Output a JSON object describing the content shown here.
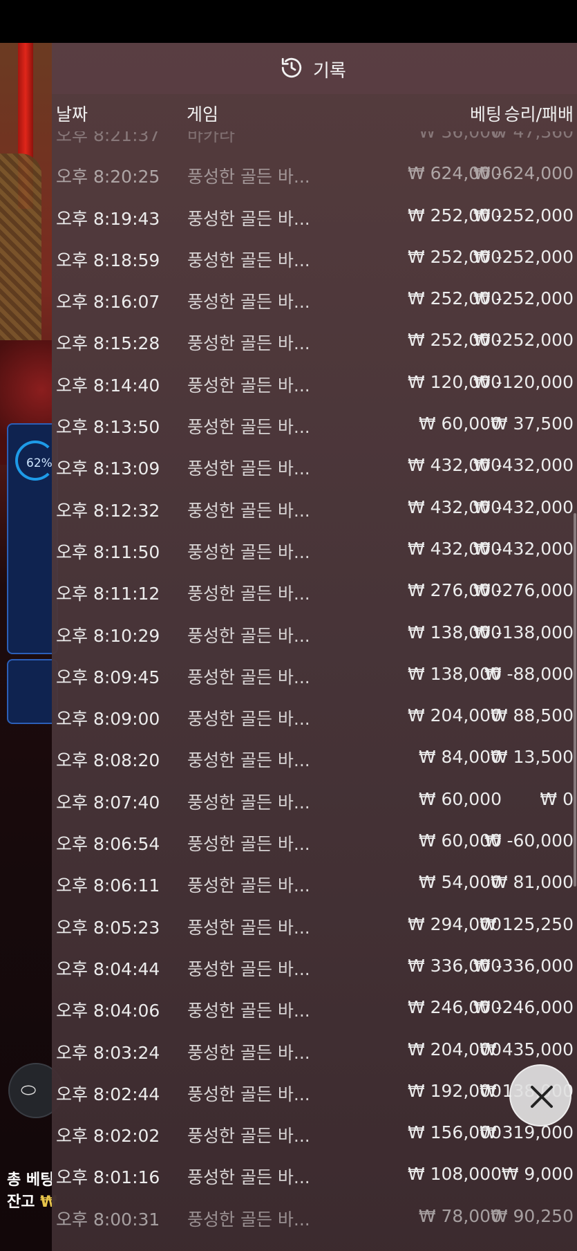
{
  "panel": {
    "title": "기록",
    "icon": "history-icon"
  },
  "columns": {
    "date": "날짜",
    "game": "게임",
    "bet": "베팅",
    "result": "승리/패배"
  },
  "rows": [
    {
      "date": "오후 8:21:37",
      "game": "바카라",
      "bet": "₩ 36,000",
      "result": "₩ 47,360"
    },
    {
      "date": "오후 8:20:25",
      "game": "풍성한 골든 바...",
      "bet": "₩ 624,000",
      "result": "₩ -624,000"
    },
    {
      "date": "오후 8:19:43",
      "game": "풍성한 골든 바...",
      "bet": "₩ 252,000",
      "result": "₩ -252,000"
    },
    {
      "date": "오후 8:18:59",
      "game": "풍성한 골든 바...",
      "bet": "₩ 252,000",
      "result": "₩ -252,000"
    },
    {
      "date": "오후 8:16:07",
      "game": "풍성한 골든 바...",
      "bet": "₩ 252,000",
      "result": "₩ -252,000"
    },
    {
      "date": "오후 8:15:28",
      "game": "풍성한 골든 바...",
      "bet": "₩ 252,000",
      "result": "₩ -252,000"
    },
    {
      "date": "오후 8:14:40",
      "game": "풍성한 골든 바...",
      "bet": "₩ 120,000",
      "result": "₩ -120,000"
    },
    {
      "date": "오후 8:13:50",
      "game": "풍성한 골든 바...",
      "bet": "₩ 60,000",
      "result": "₩ 37,500"
    },
    {
      "date": "오후 8:13:09",
      "game": "풍성한 골든 바...",
      "bet": "₩ 432,000",
      "result": "₩ -432,000"
    },
    {
      "date": "오후 8:12:32",
      "game": "풍성한 골든 바...",
      "bet": "₩ 432,000",
      "result": "₩ -432,000"
    },
    {
      "date": "오후 8:11:50",
      "game": "풍성한 골든 바...",
      "bet": "₩ 432,000",
      "result": "₩ -432,000"
    },
    {
      "date": "오후 8:11:12",
      "game": "풍성한 골든 바...",
      "bet": "₩ 276,000",
      "result": "₩ -276,000"
    },
    {
      "date": "오후 8:10:29",
      "game": "풍성한 골든 바...",
      "bet": "₩ 138,000",
      "result": "₩ -138,000"
    },
    {
      "date": "오후 8:09:45",
      "game": "풍성한 골든 바...",
      "bet": "₩ 138,000",
      "result": "₩ -88,000"
    },
    {
      "date": "오후 8:09:00",
      "game": "풍성한 골든 바...",
      "bet": "₩ 204,000",
      "result": "₩ 88,500"
    },
    {
      "date": "오후 8:08:20",
      "game": "풍성한 골든 바...",
      "bet": "₩ 84,000",
      "result": "₩ 13,500"
    },
    {
      "date": "오후 8:07:40",
      "game": "풍성한 골든 바...",
      "bet": "₩ 60,000",
      "result": "₩ 0"
    },
    {
      "date": "오후 8:06:54",
      "game": "풍성한 골든 바...",
      "bet": "₩ 60,000",
      "result": "₩ -60,000"
    },
    {
      "date": "오후 8:06:11",
      "game": "풍성한 골든 바...",
      "bet": "₩ 54,000",
      "result": "₩ 81,000"
    },
    {
      "date": "오후 8:05:23",
      "game": "풍성한 골든 바...",
      "bet": "₩ 294,000",
      "result": "₩ 125,250"
    },
    {
      "date": "오후 8:04:44",
      "game": "풍성한 골든 바...",
      "bet": "₩ 336,000",
      "result": "₩ -336,000"
    },
    {
      "date": "오후 8:04:06",
      "game": "풍성한 골든 바...",
      "bet": "₩ 246,000",
      "result": "₩ -246,000"
    },
    {
      "date": "오후 8:03:24",
      "game": "풍성한 골든 바...",
      "bet": "₩ 204,000",
      "result": "₩ 435,000"
    },
    {
      "date": "오후 8:02:44",
      "game": "풍성한 골든 바...",
      "bet": "₩ 192,000",
      "result": "₩ 138,000"
    },
    {
      "date": "오후 8:02:02",
      "game": "풍성한 골든 바...",
      "bet": "₩ 156,000",
      "result": "₩ 319,000"
    },
    {
      "date": "오후 8:01:16",
      "game": "풍성한 골든 바...",
      "bet": "₩ 108,000",
      "result": "₩ 9,000"
    },
    {
      "date": "오후 8:00:31",
      "game": "풍성한 골든 바...",
      "bet": "₩ 78,000",
      "result": "₩ 90,250"
    }
  ],
  "background": {
    "gauge_text": "62%",
    "total_bet_label": "총 베팅",
    "balance_label": "잔고",
    "balance_currency": "₩"
  },
  "close_icon": "close-icon"
}
